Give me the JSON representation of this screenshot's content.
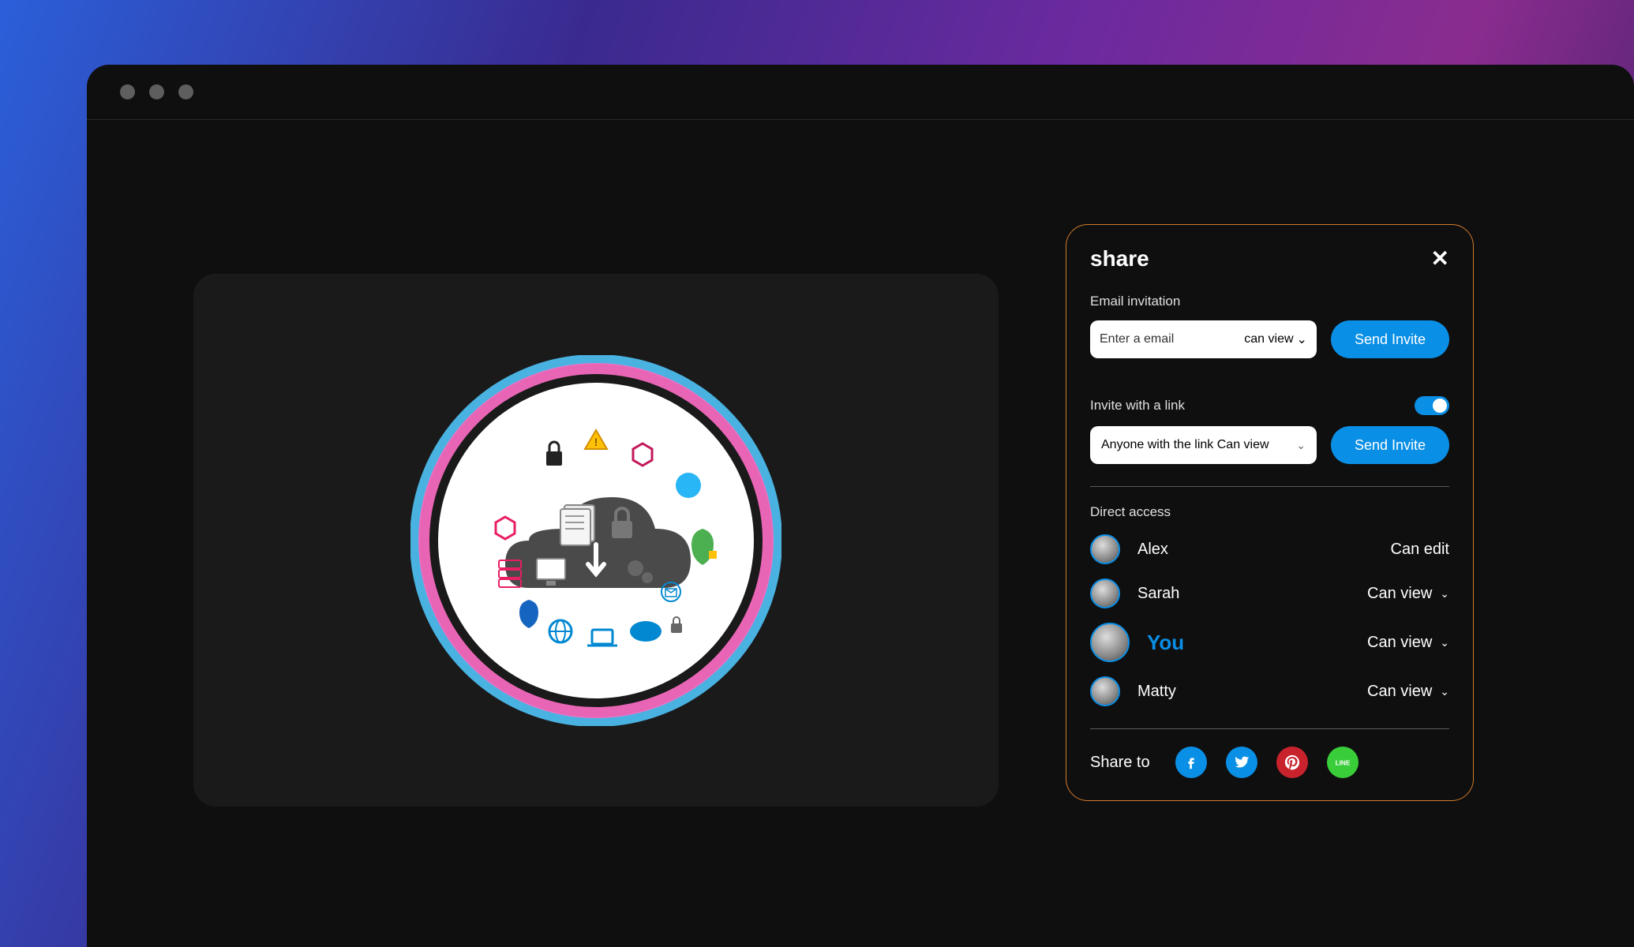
{
  "share": {
    "title": "share",
    "email_section_label": "Email invitation",
    "email_placeholder": "Enter a email",
    "email_permission": "can view",
    "send_invite_label": "Send Invite",
    "link_section_label": "Invite with a link",
    "link_toggle": true,
    "link_permission": "Anyone with the link Can view",
    "direct_access_label": "Direct access",
    "users": [
      {
        "name": "Alex",
        "permission": "Can edit",
        "has_dropdown": false,
        "is_you": false,
        "avatar_large": false
      },
      {
        "name": "Sarah",
        "permission": "Can view",
        "has_dropdown": true,
        "is_you": false,
        "avatar_large": false
      },
      {
        "name": "You",
        "permission": "Can view",
        "has_dropdown": true,
        "is_you": true,
        "avatar_large": true
      },
      {
        "name": "Matty",
        "permission": "Can view",
        "has_dropdown": true,
        "is_you": false,
        "avatar_large": false
      }
    ],
    "share_to_label": "Share to",
    "socials": [
      "facebook",
      "twitter",
      "pinterest",
      "line"
    ]
  }
}
